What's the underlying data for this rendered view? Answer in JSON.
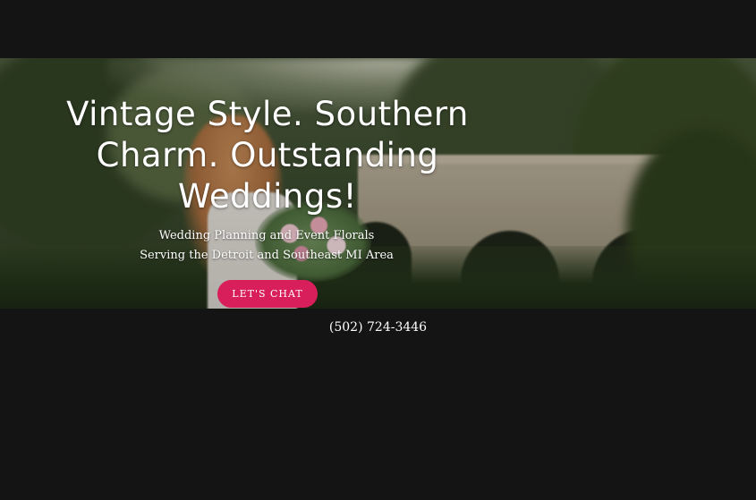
{
  "hero": {
    "title": "Vintage Style. Southern Charm. Outstanding Weddings!",
    "subtitle_line1": "Wedding Planning and Event Florals",
    "subtitle_line2": "Serving the Detroit and Southeast MI Area",
    "cta_label": "LET'S CHAT",
    "background_image": "bride-holding-bouquet-near-stone-bridge"
  },
  "contact": {
    "phone": "(502) 724-3446"
  },
  "colors": {
    "background": "#141414",
    "cta": "#d81f5c",
    "text": "#ffffff"
  }
}
